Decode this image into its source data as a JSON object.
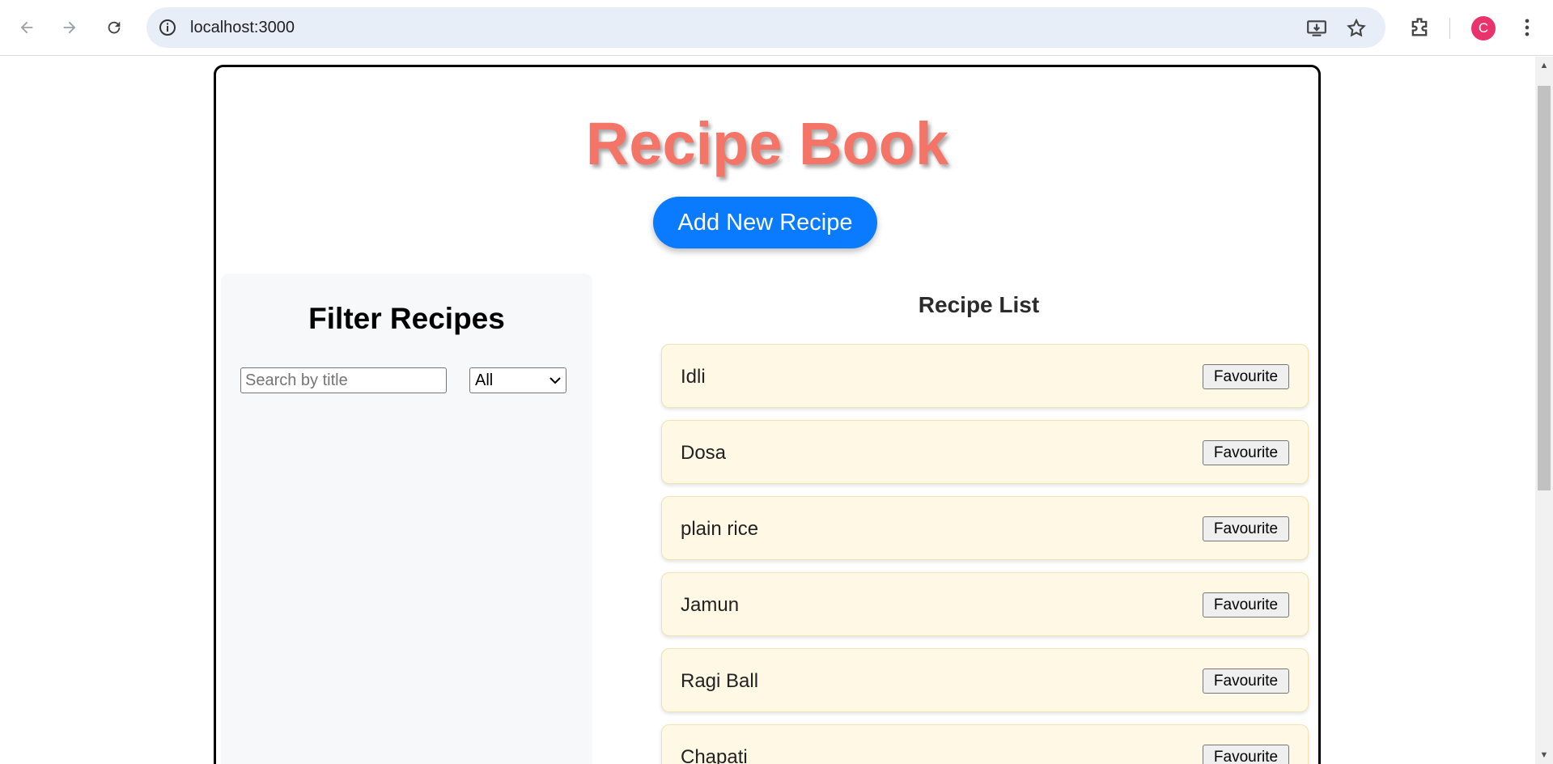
{
  "browser": {
    "url": "localhost:3000",
    "avatar_letter": "C"
  },
  "app": {
    "title": "Recipe Book",
    "add_button": "Add New Recipe"
  },
  "filter": {
    "heading": "Filter Recipes",
    "search_placeholder": "Search by title",
    "category_selected": "All"
  },
  "list": {
    "heading": "Recipe List",
    "favourite_label": "Favourite",
    "recipes": [
      "Idli",
      "Dosa",
      "plain rice",
      "Jamun",
      "Ragi Ball",
      "Chapati"
    ]
  },
  "colors": {
    "title": "#f47468",
    "add_button": "#0a7bff",
    "card_bg": "#fff8e4"
  }
}
